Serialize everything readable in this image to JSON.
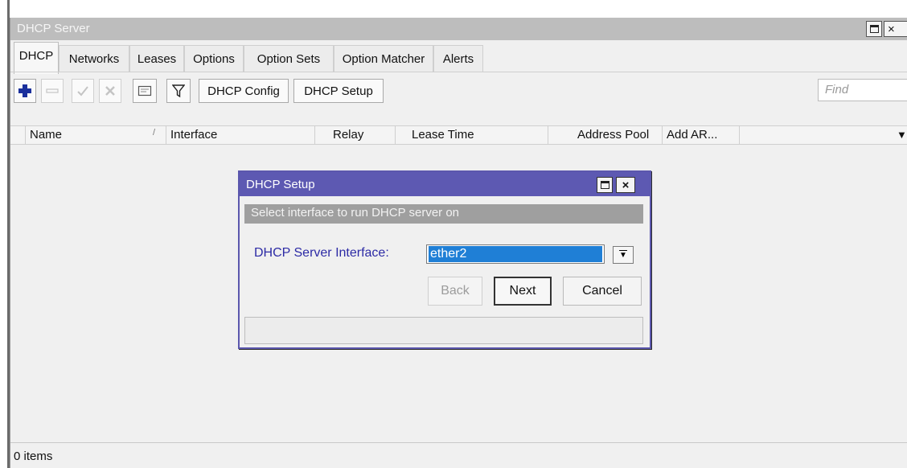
{
  "window": {
    "title": "DHCP Server",
    "maximize_icon": "maximize-icon",
    "close_label": "×"
  },
  "tabs": [
    {
      "label": "DHCP",
      "active": true
    },
    {
      "label": "Networks",
      "active": false
    },
    {
      "label": "Leases",
      "active": false
    },
    {
      "label": "Options",
      "active": false
    },
    {
      "label": "Option Sets",
      "active": false
    },
    {
      "label": "Option Matcher",
      "active": false
    },
    {
      "label": "Alerts",
      "active": false
    }
  ],
  "toolbar": {
    "add_icon": "plus-icon",
    "remove_icon": "minus-icon",
    "enable_icon": "check-icon",
    "disable_icon": "cross-icon",
    "comment_icon": "comment-icon",
    "filter_icon": "filter-icon",
    "dhcp_config_label": "DHCP Config",
    "dhcp_setup_label": "DHCP Setup",
    "find_placeholder": "Find"
  },
  "columns": [
    {
      "label": "Name"
    },
    {
      "label": "Interface"
    },
    {
      "label": "Relay"
    },
    {
      "label": "Lease Time"
    },
    {
      "label": "Address Pool"
    },
    {
      "label": "Add AR..."
    },
    {
      "label": ""
    }
  ],
  "sort_indicator": "/",
  "column_menu_icon": "▼",
  "status": {
    "items": "0 items"
  },
  "dialog": {
    "title": "DHCP Setup",
    "subtitle": "Select interface to run DHCP server on",
    "interface_label": "DHCP Server Interface:",
    "interface_value": "ether2",
    "dropdown_icon": "▼",
    "back_label": "Back",
    "next_label": "Next",
    "cancel_label": "Cancel",
    "close_label": "×"
  },
  "colors": {
    "dialog_title_bg": "#5d59b2",
    "selected_value_bg": "#1f7fd6",
    "label_blue": "#2c2aa5",
    "add_icon_blue": "#1a2f9c"
  }
}
